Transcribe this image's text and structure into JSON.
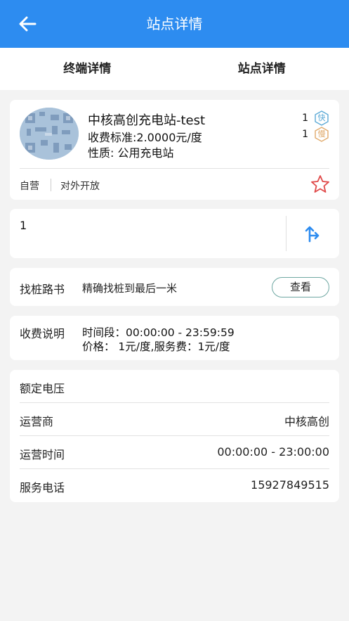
{
  "header": {
    "title": "站点详情"
  },
  "tabs": [
    {
      "label": "终端详情"
    },
    {
      "label": "站点详情"
    }
  ],
  "station": {
    "name": "中核高创充电站-test",
    "fee": "收费标准:2.0000元/度",
    "type": "性质: 公用充电站",
    "fast_count": "1",
    "fast_label": "快",
    "slow_count": "1",
    "slow_label": "慢",
    "tags": [
      "自营",
      "对外开放"
    ],
    "fast_color": "#5aa9d6",
    "slow_color": "#e0a96a",
    "fav_color": "#e04a4a"
  },
  "address": {
    "text": "1"
  },
  "guide": {
    "label": "找桩路书",
    "desc": "精确找桩到最后一米",
    "button": "查看"
  },
  "fee_info": {
    "label": "收费说明",
    "line1": "时间段：00:00:00 - 23:59:59",
    "line2": "价格：  1元/度,服务费：1元/度"
  },
  "info": [
    {
      "key": "额定电压",
      "value": ""
    },
    {
      "key": "运营商",
      "value": "中核高创"
    },
    {
      "key": "运营时间",
      "value": "00:00:00 - 23:00:00"
    },
    {
      "key": "服务电话",
      "value": "15927849515"
    }
  ],
  "colors": {
    "primary": "#2d8cf0",
    "background": "#f3f3f3"
  }
}
